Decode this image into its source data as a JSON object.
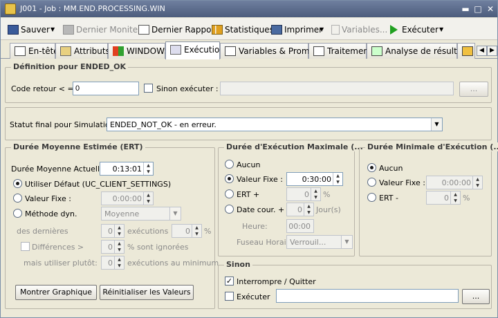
{
  "window": {
    "title": "J001 - Job : MM.END.PROCESSING.WIN",
    "min": "▬",
    "max": "□",
    "close": "✕"
  },
  "toolbar": {
    "save": "Sauver",
    "dropdown_glyph": "▼",
    "last_monitor": "Dernier Moniteur",
    "last_report": "Dernier Rapport",
    "stats": "Statistiques",
    "print": "Imprimer",
    "variables": "Variables...",
    "execute": "Exécuter"
  },
  "tabs": [
    "En-tête",
    "Attributs",
    "WINDOWS",
    "Exécution",
    "Variables & Prompts",
    "Traitement",
    "Analyse de résultats"
  ],
  "active_tab": "Exécution",
  "nav": {
    "left": "◀",
    "right": "▶"
  },
  "definition": {
    "legend": "Définition pour ENDED_OK",
    "code_label": "Code retour < =:",
    "code_value": "0",
    "else_exec_label": "Sinon exécuter :",
    "else_exec_value": "",
    "browse": "..."
  },
  "simulation": {
    "label": "Statut final pour Simulation:",
    "value": "ENDED_NOT_OK - en erreur."
  },
  "ert": {
    "legend": "Durée Moyenne Estimée (ERT)",
    "current_label": "Durée Moyenne Actuelle:",
    "current_value": "0:13:01",
    "use_default": "Utiliser Défaut (UC_CLIENT_SETTINGS)",
    "fixed_label": "Valeur Fixe :",
    "fixed_value": "0:00:00",
    "dyn_label": "Méthode dyn.",
    "dyn_value": "Moyenne",
    "last_label": "des dernières",
    "last_value": "0",
    "exec_plus": "exécutions +",
    "pct_value": "0",
    "pct": "%",
    "diff_label": "Différences >",
    "diff_value": "0",
    "ignored": "% sont ignorées",
    "but_use": "mais utiliser plutôt:",
    "min_value": "0",
    "min_exec": "exécutions au minimum",
    "show_graph": "Montrer Graphique",
    "reset": "Réinitialiser les Valeurs"
  },
  "max_duration": {
    "legend": "Durée d'Exécution Maximale (...",
    "none": "Aucun",
    "fixed_label": "Valeur Fixe :",
    "fixed_value": "0:30:00",
    "ert_plus": "ERT +",
    "ert_value": "0",
    "pct": "%",
    "date_label": "Date cour. +",
    "date_value": "0",
    "days": "Jour(s)",
    "time_label": "Heure:",
    "time_value": "00:00",
    "tz_label": "Fuseau Horaire:",
    "tz_value": "Verrouil..."
  },
  "min_duration": {
    "legend": "Durée Minimale d'Exécution (...",
    "none": "Aucun",
    "fixed_label": "Valeur Fixe :",
    "fixed_value": "0:00:00",
    "ert_minus": "ERT -",
    "ert_value": "0",
    "pct": "%"
  },
  "else_group": {
    "legend": "Sinon",
    "abort": "Interrompre / Quitter",
    "execute": "Exécuter",
    "execute_value": "",
    "browse": "..."
  }
}
